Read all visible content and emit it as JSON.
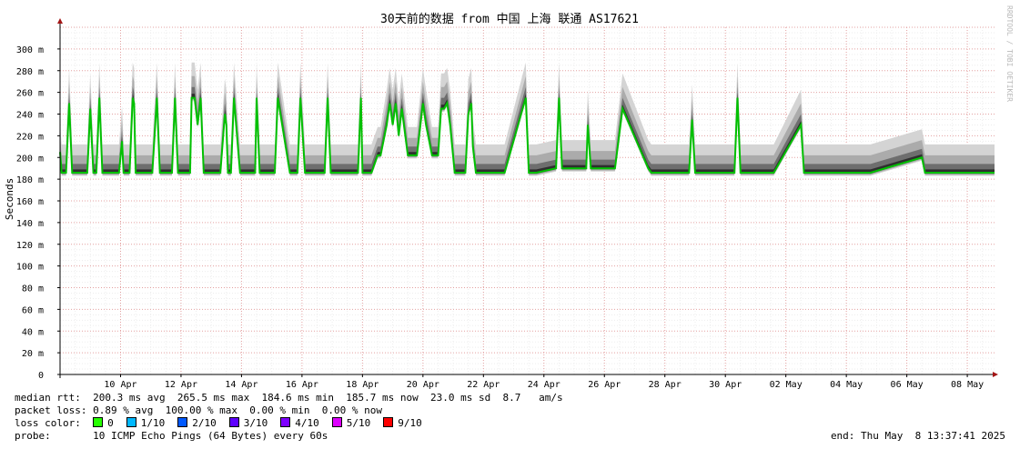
{
  "chart_data": {
    "type": "line",
    "title": "30天前的数据 from 中国 上海 联通 AS17621",
    "ylabel": "Seconds",
    "watermark": "RRDTOOL / TOBI OETIKER",
    "ylim": [
      0,
      320
    ],
    "y_ticks": [
      {
        "v": 0,
        "label": "0"
      },
      {
        "v": 20,
        "label": "20 m"
      },
      {
        "v": 40,
        "label": "40 m"
      },
      {
        "v": 60,
        "label": "60 m"
      },
      {
        "v": 80,
        "label": "80 m"
      },
      {
        "v": 100,
        "label": "100 m"
      },
      {
        "v": 120,
        "label": "120 m"
      },
      {
        "v": 140,
        "label": "140 m"
      },
      {
        "v": 160,
        "label": "160 m"
      },
      {
        "v": 180,
        "label": "180 m"
      },
      {
        "v": 200,
        "label": "200 m"
      },
      {
        "v": 220,
        "label": "220 m"
      },
      {
        "v": 240,
        "label": "240 m"
      },
      {
        "v": 260,
        "label": "260 m"
      },
      {
        "v": 280,
        "label": "280 m"
      },
      {
        "v": 300,
        "label": "300 m"
      }
    ],
    "x_range_days": [
      8.0,
      38.9
    ],
    "x_ticks": [
      {
        "d": 10,
        "label": "10 Apr"
      },
      {
        "d": 12,
        "label": "12 Apr"
      },
      {
        "d": 14,
        "label": "14 Apr"
      },
      {
        "d": 16,
        "label": "16 Apr"
      },
      {
        "d": 18,
        "label": "18 Apr"
      },
      {
        "d": 20,
        "label": "20 Apr"
      },
      {
        "d": 22,
        "label": "22 Apr"
      },
      {
        "d": 24,
        "label": "24 Apr"
      },
      {
        "d": 26,
        "label": "26 Apr"
      },
      {
        "d": 28,
        "label": "28 Apr"
      },
      {
        "d": 30,
        "label": "30 Apr"
      },
      {
        "d": 32,
        "label": "02 May"
      },
      {
        "d": 34,
        "label": "04 May"
      },
      {
        "d": 36,
        "label": "06 May"
      },
      {
        "d": 38,
        "label": "08 May"
      }
    ],
    "grid": true,
    "series": [
      {
        "name": "median rtt",
        "color": "#00c000",
        "x_days": [
          8.0,
          8.05,
          8.2,
          8.3,
          8.4,
          8.5,
          8.6,
          8.9,
          9.0,
          9.1,
          9.2,
          9.3,
          9.4,
          9.8,
          9.95,
          10.05,
          10.1,
          10.2,
          10.3,
          10.4,
          10.45,
          10.5,
          10.6,
          10.8,
          10.9,
          11.0,
          11.05,
          11.2,
          11.3,
          11.7,
          11.8,
          11.9,
          12.0,
          12.1,
          12.3,
          12.35,
          12.45,
          12.55,
          12.65,
          12.75,
          12.85,
          12.95,
          13.05,
          13.3,
          13.45,
          13.5,
          13.55,
          13.65,
          13.75,
          13.95,
          14.0,
          14.05,
          14.2,
          14.3,
          14.45,
          14.5,
          14.6,
          14.75,
          14.85,
          14.95,
          15.0,
          15.1,
          15.2,
          15.6,
          15.7,
          15.85,
          15.95,
          16.1,
          16.7,
          16.75,
          16.85,
          16.95,
          17.6,
          17.7,
          17.75,
          17.85,
          17.95,
          18.0,
          18.1,
          18.3,
          18.5,
          18.6,
          18.8,
          18.9,
          19.0,
          19.1,
          19.2,
          19.3,
          19.5,
          19.7,
          19.8,
          20.0,
          20.1,
          20.3,
          20.5,
          20.6,
          20.7,
          20.8,
          20.9,
          21.05,
          21.3,
          21.4,
          21.5,
          21.6,
          21.65,
          21.75,
          21.85,
          22.0,
          22.2,
          22.35,
          22.45,
          22.6,
          22.7,
          23.4,
          23.5,
          23.6,
          23.7,
          23.75,
          24.4,
          24.5,
          24.6,
          24.7,
          24.8,
          24.9,
          25.3,
          25.4,
          25.45,
          25.55,
          25.7,
          26.1,
          26.2,
          26.25,
          26.35,
          26.6,
          27.45,
          27.55,
          27.65,
          28.8,
          28.9,
          29.0,
          29.1,
          29.6,
          29.75,
          29.85,
          30.3,
          30.4,
          30.5,
          31.3,
          31.5,
          31.6,
          32.5,
          32.6,
          33.7,
          33.8,
          33.9,
          34.0,
          34.7,
          34.8,
          36.5,
          36.6,
          36.7,
          37.3,
          37.4,
          37.5,
          38.9
        ],
        "y": [
          205,
          186,
          186,
          250,
          186,
          186,
          186,
          186,
          245,
          186,
          186,
          255,
          186,
          186,
          186,
          215,
          186,
          186,
          186,
          255,
          250,
          186,
          186,
          186,
          186,
          186,
          186,
          255,
          186,
          186,
          255,
          186,
          186,
          186,
          186,
          255,
          255,
          230,
          255,
          186,
          186,
          186,
          186,
          186,
          240,
          230,
          186,
          186,
          255,
          186,
          186,
          186,
          186,
          186,
          186,
          255,
          186,
          186,
          186,
          186,
          186,
          186,
          255,
          186,
          186,
          186,
          255,
          186,
          186,
          186,
          255,
          186,
          186,
          186,
          186,
          186,
          255,
          186,
          186,
          186,
          202,
          202,
          230,
          250,
          230,
          250,
          220,
          245,
          202,
          202,
          202,
          250,
          230,
          202,
          202,
          245,
          245,
          250,
          230,
          186,
          186,
          186,
          240,
          250,
          210,
          186,
          186,
          186,
          186,
          186,
          186,
          186,
          186,
          255,
          186,
          186,
          186,
          186,
          190,
          255,
          190,
          190,
          190,
          190,
          190,
          190,
          230,
          190,
          190,
          190,
          190,
          190,
          190,
          245,
          190,
          186,
          186,
          186,
          235,
          186,
          186,
          186,
          186,
          186,
          186,
          255,
          186,
          186,
          186,
          186,
          230,
          186,
          186,
          186,
          186,
          186,
          186,
          186,
          200,
          186,
          186,
          186,
          186,
          186,
          186,
          186,
          186,
          186,
          186,
          186,
          203,
          203,
          186,
          186,
          186
        ]
      }
    ]
  },
  "legend": {
    "median": {
      "label": "median rtt:",
      "values": "200.3 ms avg  265.5 ms max  184.6 ms min  185.7 ms now  23.0 ms sd  8.7   am/s"
    },
    "loss": {
      "label": "packet loss:",
      "values": "0.89 % avg  100.00 % max  0.00 % min  0.00 % now"
    },
    "loss_color_label": "loss color:",
    "loss_colors": [
      {
        "label": "0",
        "color": "#26ff00"
      },
      {
        "label": "1/10",
        "color": "#00b8ff"
      },
      {
        "label": "2/10",
        "color": "#0059ff"
      },
      {
        "label": "3/10",
        "color": "#5e00ff"
      },
      {
        "label": "4/10",
        "color": "#7e00ff"
      },
      {
        "label": "5/10",
        "color": "#dd00ff"
      },
      {
        "label": "9/10",
        "color": "#ff0000"
      }
    ],
    "probe_label": "probe:",
    "probe_value": "10 ICMP Echo Pings (64 Bytes) every 60s",
    "end_label": "end: Thu May  8 13:37:41 2025"
  }
}
